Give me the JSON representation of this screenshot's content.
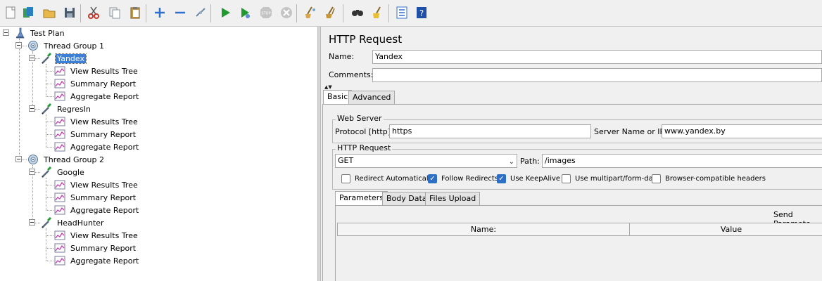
{
  "toolbar": {
    "buttons": [
      {
        "name": "new-icon",
        "color": "#e8e8e8"
      },
      {
        "name": "templates-icon",
        "color": "#2e8b57"
      },
      {
        "name": "open-icon",
        "color": "#e8b84a"
      },
      {
        "name": "save-icon",
        "color": "#4a5a6a"
      },
      {
        "name": "cut-icon",
        "color": "#c0392b"
      },
      {
        "name": "copy-icon",
        "color": "#9aa4ad"
      },
      {
        "name": "paste-icon",
        "color": "#b58a3a"
      },
      {
        "name": "expand-icon",
        "color": "#2e6fd0"
      },
      {
        "name": "collapse-icon",
        "color": "#2e6fd0"
      },
      {
        "name": "toggle-icon",
        "color": "#6a8aa8"
      },
      {
        "name": "start-icon",
        "color": "#1f9a2f"
      },
      {
        "name": "start-no-pauses-icon",
        "color": "#1f9a2f"
      },
      {
        "name": "stop-icon",
        "color": "#b0b0b0"
      },
      {
        "name": "shutdown-icon",
        "color": "#b0b0b0"
      },
      {
        "name": "clear-icon",
        "color": "#b5853a"
      },
      {
        "name": "clear-all-icon",
        "color": "#b5853a"
      },
      {
        "name": "search-icon",
        "color": "#222222"
      },
      {
        "name": "reset-search-icon",
        "color": "#e0b020"
      },
      {
        "name": "function-helper-icon",
        "color": "#2e6fd0"
      },
      {
        "name": "help-icon",
        "color": "#1f4fa8"
      }
    ]
  },
  "tree": {
    "nodes": [
      {
        "label": "Test Plan",
        "type": "plan",
        "level": 0,
        "expanded": true
      },
      {
        "label": "Thread Group 1",
        "type": "thread",
        "level": 1,
        "expanded": true
      },
      {
        "label": "Yandex",
        "type": "sampler",
        "level": 2,
        "expanded": true,
        "selected": true
      },
      {
        "label": "View Results Tree",
        "type": "listener",
        "level": 3
      },
      {
        "label": "Summary Report",
        "type": "listener",
        "level": 3
      },
      {
        "label": "Aggregate Report",
        "type": "listener",
        "level": 3
      },
      {
        "label": "RegresIn",
        "type": "sampler",
        "level": 2,
        "expanded": true
      },
      {
        "label": "View Results Tree",
        "type": "listener",
        "level": 3
      },
      {
        "label": "Summary Report",
        "type": "listener",
        "level": 3
      },
      {
        "label": "Aggregate Report",
        "type": "listener",
        "level": 3
      },
      {
        "label": "Thread Group 2",
        "type": "thread",
        "level": 1,
        "expanded": true
      },
      {
        "label": "Google",
        "type": "sampler",
        "level": 2,
        "expanded": true
      },
      {
        "label": "View Results Tree",
        "type": "listener",
        "level": 3
      },
      {
        "label": "Summary Report",
        "type": "listener",
        "level": 3
      },
      {
        "label": "Aggregate Report",
        "type": "listener",
        "level": 3
      },
      {
        "label": "HeadHunter",
        "type": "sampler",
        "level": 2,
        "expanded": true
      },
      {
        "label": "View Results Tree",
        "type": "listener",
        "level": 3
      },
      {
        "label": "Summary Report",
        "type": "listener",
        "level": 3
      },
      {
        "label": "Aggregate Report",
        "type": "listener",
        "level": 3
      }
    ]
  },
  "panel": {
    "title": "HTTP Request",
    "name_label": "Name:",
    "name_value": "Yandex",
    "comments_label": "Comments:",
    "comments_value": "",
    "collapse_glyph": "▲▼",
    "tabs": [
      "Basic",
      "Advanced"
    ],
    "web_server": {
      "title": "Web Server",
      "protocol_label": "Protocol [http]:",
      "protocol_value": "https",
      "server_label": "Server Name or IP:",
      "server_value": "www.yandex.by"
    },
    "http_request": {
      "title": "HTTP Request",
      "method": "GET",
      "path_label": "Path:",
      "path_value": "/images",
      "options": [
        {
          "label": "Redirect Automatically",
          "checked": false
        },
        {
          "label": "Follow Redirects",
          "checked": true
        },
        {
          "label": "Use KeepAlive",
          "checked": true
        },
        {
          "label": "Use multipart/form-data",
          "checked": false
        },
        {
          "label": "Browser-compatible headers",
          "checked": false
        }
      ]
    },
    "subtabs": [
      "Parameters",
      "Body Data",
      "Files Upload"
    ],
    "send_params_label": "Send Paramete",
    "columns": [
      "Name:",
      "Value"
    ]
  }
}
